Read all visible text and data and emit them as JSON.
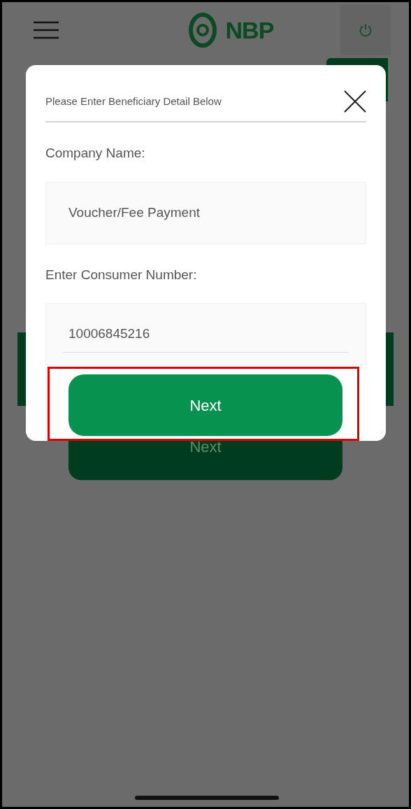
{
  "header": {
    "logo_text": "NBP"
  },
  "background_button": {
    "label": "Next"
  },
  "dialog": {
    "title": "Please Enter Beneficiary Detail Below",
    "fields": [
      {
        "label": "Company Name:",
        "value": "Voucher/Fee Payment",
        "underlined": false
      },
      {
        "label": "Enter Consumer Number:",
        "value": "10006845216",
        "underlined": true
      }
    ],
    "button": {
      "label": "Next",
      "highlighted": true
    }
  }
}
